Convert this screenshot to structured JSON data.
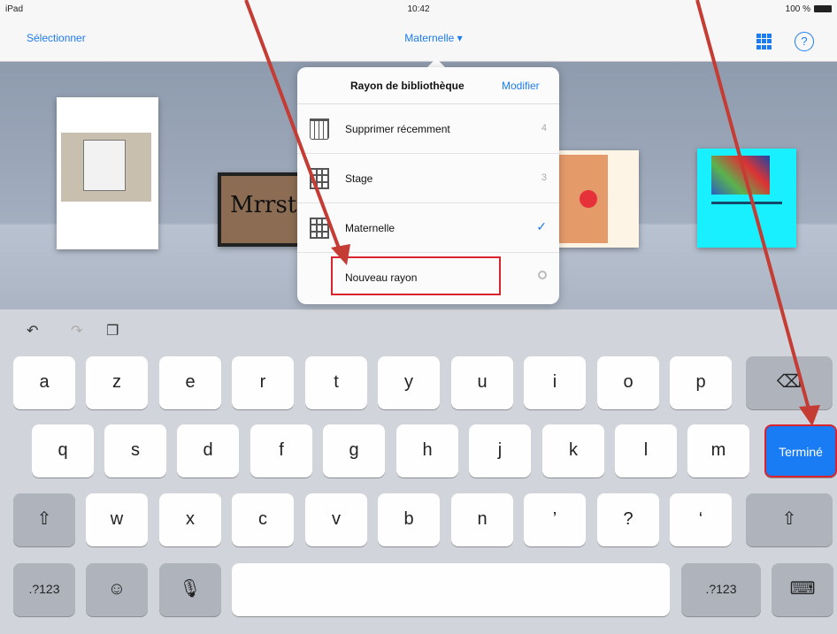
{
  "status_bar": {
    "left": "iPad",
    "time": "10:42",
    "battery": "100 %"
  },
  "nav": {
    "select": "Sélectionner",
    "title": "Maternelle ▾",
    "help": "?"
  },
  "popover": {
    "title": "Rayon de bibliothèque",
    "edit": "Modifier",
    "rows": [
      {
        "label": "Supprimer récemment",
        "count": "4"
      },
      {
        "label": "Stage",
        "count": "3"
      },
      {
        "label": "Maternelle",
        "check": "✓"
      },
      {
        "label": "Nouveau rayon"
      }
    ]
  },
  "books": {
    "book2_text": "Mrrst"
  },
  "keyboard": {
    "toolbar": {
      "undo": "↶",
      "redo": "↷",
      "paste": "❐"
    },
    "row1": [
      "a",
      "z",
      "e",
      "r",
      "t",
      "y",
      "u",
      "i",
      "o",
      "p"
    ],
    "backspace": "⌫",
    "row2": [
      "q",
      "s",
      "d",
      "f",
      "g",
      "h",
      "j",
      "k",
      "l",
      "m"
    ],
    "done": "Terminé",
    "row3": [
      "w",
      "x",
      "c",
      "v",
      "b",
      "n",
      "’",
      "?",
      "‘"
    ],
    "shift": "⇧",
    "numbers": ".?123",
    "emoji": "☺",
    "mic": "🎙",
    "hide_keyboard": "⌨"
  },
  "annotation_color": "#c43c33"
}
